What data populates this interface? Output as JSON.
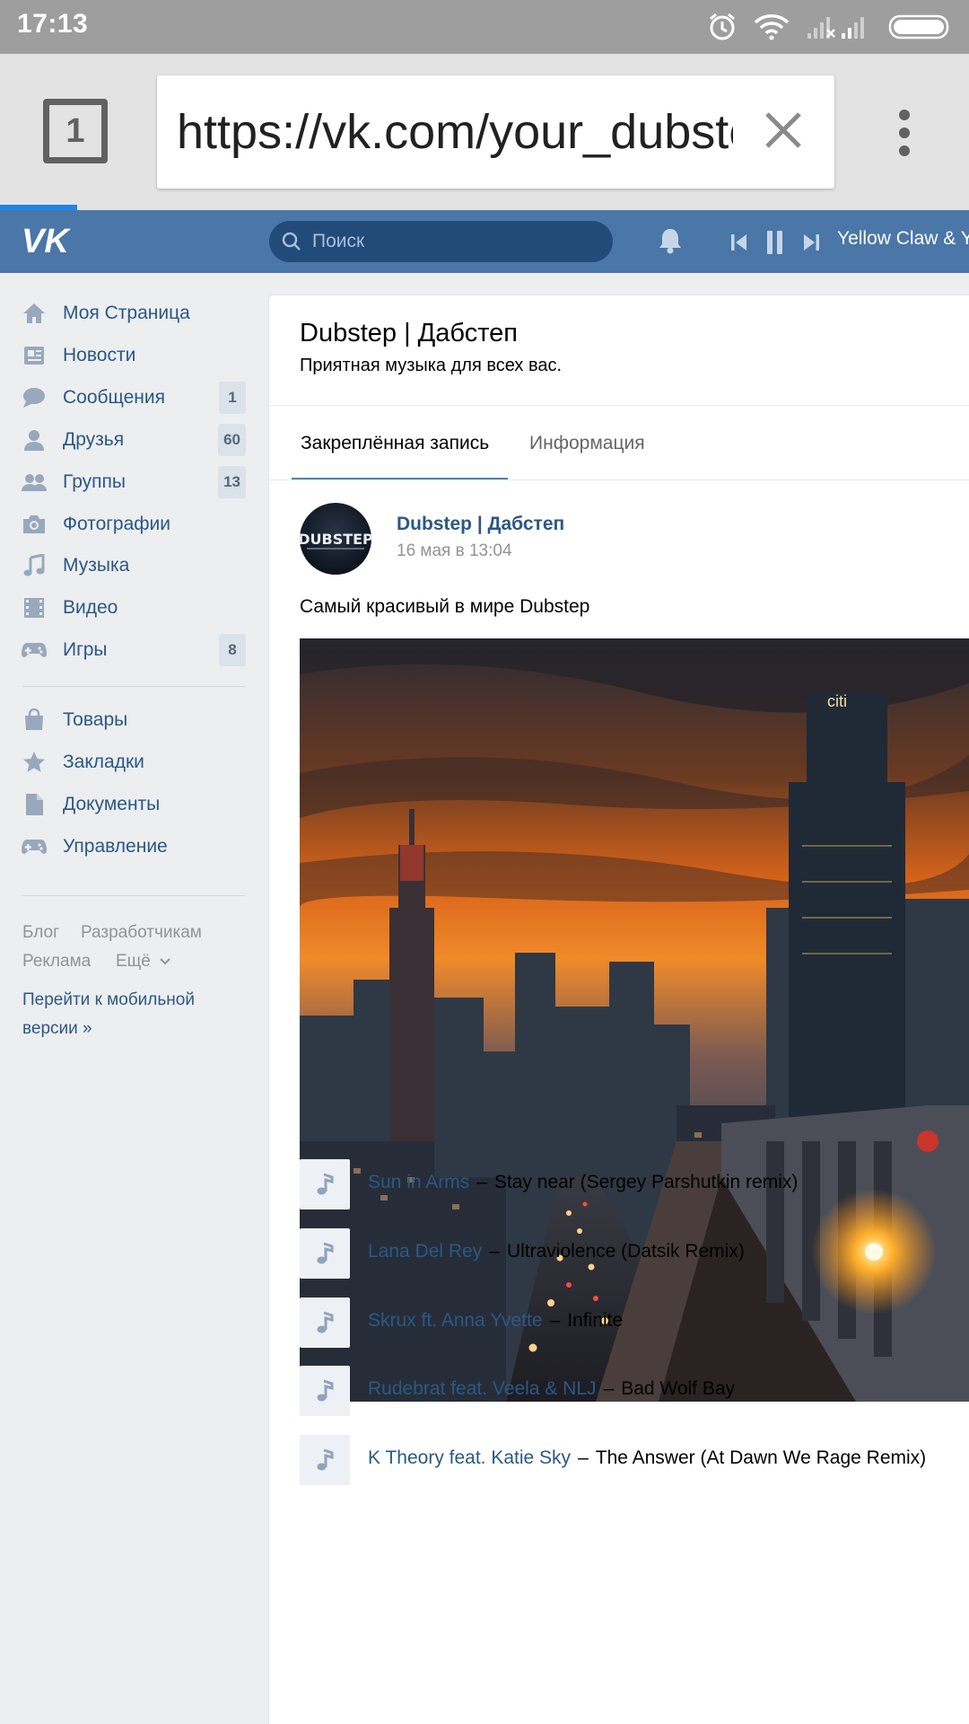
{
  "status_bar": {
    "time": "17:13",
    "icons": [
      "alarm-icon",
      "wifi-icon",
      "signal-icon",
      "battery-icon"
    ]
  },
  "browser": {
    "tab_count": "1",
    "url": "https://vk.com/your_dubstep",
    "icons": [
      "close-icon",
      "overflow-menu-icon"
    ],
    "load_progress": 0.08
  },
  "vk_header": {
    "search_placeholder": "Поиск",
    "now_playing": "Yellow Claw & Y",
    "icons": [
      "vk-logo",
      "search-icon",
      "bell-icon",
      "previous-icon",
      "pause-icon",
      "next-icon"
    ],
    "colors": {
      "header_bg": "#4a76a8",
      "search_bg": "#224b7a"
    }
  },
  "sidebar": {
    "items": [
      {
        "label": "Моя Страница",
        "icon": "home-icon",
        "badge": ""
      },
      {
        "label": "Новости",
        "icon": "news-icon",
        "badge": ""
      },
      {
        "label": "Сообщения",
        "icon": "messages-icon",
        "badge": "1"
      },
      {
        "label": "Друзья",
        "icon": "friends-icon",
        "badge": "60"
      },
      {
        "label": "Группы",
        "icon": "groups-icon",
        "badge": "13"
      },
      {
        "label": "Фотографии",
        "icon": "camera-icon",
        "badge": ""
      },
      {
        "label": "Музыка",
        "icon": "music-icon",
        "badge": ""
      },
      {
        "label": "Видео",
        "icon": "video-icon",
        "badge": ""
      },
      {
        "label": "Игры",
        "icon": "gamepad-icon",
        "badge": "8"
      }
    ],
    "items2": [
      {
        "label": "Товары",
        "icon": "bag-icon"
      },
      {
        "label": "Закладки",
        "icon": "star-icon"
      },
      {
        "label": "Документы",
        "icon": "document-icon"
      },
      {
        "label": "Управление",
        "icon": "gamepad-icon"
      }
    ],
    "footer": {
      "blog": "Блог",
      "developers": "Разработчикам",
      "ads": "Реклама",
      "more": "Ещё",
      "mobile": "Перейти к мобильной версии »"
    }
  },
  "group": {
    "title": "Dubstep | Дабстеп",
    "status": "Приятная музыка для всех вас.",
    "tabs": [
      "Закреплённая запись",
      "Информация"
    ]
  },
  "post": {
    "author": "Dubstep | Дабстеп",
    "date": "16 мая в 13:04",
    "text": "Самый красивый в мире Dubstep",
    "avatar_text": "DUBSTEP",
    "image_sign_text": "citi"
  },
  "tracks": [
    {
      "artist": "Sun in Arms",
      "title": "Stay near (Sergey Parshutkin remix)"
    },
    {
      "artist": "Lana Del Rey",
      "title": "Ultraviolence (Datsik Remix)"
    },
    {
      "artist": "Skrux ft. Anna Yvette",
      "title": "Infinite"
    },
    {
      "artist": "Rudebrat feat. Veela & NLJ",
      "title": "Bad Wolf Bay"
    },
    {
      "artist": "K Theory feat. Katie Sky",
      "title": "The Answer (At Dawn We Rage Remix)"
    }
  ],
  "colors": {
    "accent": "#2a5885",
    "progress": "#1e88e5"
  }
}
